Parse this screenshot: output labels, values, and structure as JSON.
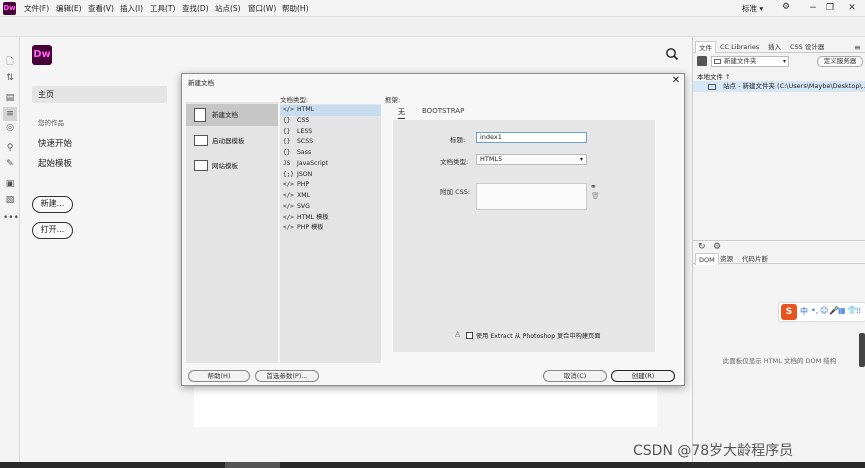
{
  "menubar": {
    "logo": "Dw",
    "items": [
      "文件(F)",
      "编辑(E)",
      "查看(V)",
      "插入(I)",
      "工具(T)",
      "查找(D)",
      "站点(S)",
      "窗口(W)",
      "帮助(H)"
    ],
    "workspace": "标准 ▾",
    "sync_icon": "sync-settings-icon"
  },
  "start_screen": {
    "logo": "Dw",
    "home": "主页",
    "recent_heading": "您的作品",
    "quick_start": "快速开始",
    "starter_templates": "起始模板",
    "new_button": "新建...",
    "open_button": "打开..."
  },
  "files_panel": {
    "tabs": [
      "文件",
      "CC Libraries",
      "插入",
      "CSS 设计器"
    ],
    "folder_select": "新建文件夹",
    "define_server": "定义服务器",
    "local_files_header": "本地文件 ↑",
    "site_row": "站点 - 新建文件夹 (C:\\Users\\Maybe\\Desktop\\..."
  },
  "dom_panel": {
    "tabs": [
      "DOM",
      "资源",
      "代码片断"
    ],
    "empty_message": "此面板仅显示 HTML 文档的 DOM 结构"
  },
  "ime_toolbar": {
    "logo": "S",
    "items": [
      "中",
      "•,",
      "☺",
      "🎤",
      "▦",
      "👕",
      "⁞⁞"
    ]
  },
  "dialog": {
    "title": "新建文档",
    "categories": [
      "新建文档",
      "启动器模板",
      "网站模板"
    ],
    "doc_type_label": "文档类型:",
    "doc_types": [
      "HTML",
      "CSS",
      "LESS",
      "SCSS",
      "Sass",
      "JavaScript",
      "JSON",
      "PHP",
      "XML",
      "SVG",
      "HTML 模板",
      "PHP 模板"
    ],
    "doc_type_icons": [
      "</>",
      "{}",
      "{}",
      "{}",
      "{}",
      "JS",
      "{;}",
      "</>",
      "</>",
      "</>",
      "</>",
      "</>"
    ],
    "framework_label": "框架:",
    "framework_tabs": [
      "无",
      "BOOTSTRAP"
    ],
    "title_label": "标题:",
    "title_value": "index1",
    "doctype_label": "文档类型:",
    "doctype_value": "HTML5",
    "attach_css_label": "附加 CSS:",
    "extract_label": "使用 Extract 从 Photoshop 复合中构建页面",
    "help_button": "帮助(H)",
    "prefs_button": "首选参数(P)...",
    "cancel_button": "取消(C)",
    "create_button": "创建(R)"
  },
  "watermark": "CSDN @78岁大龄程序员"
}
